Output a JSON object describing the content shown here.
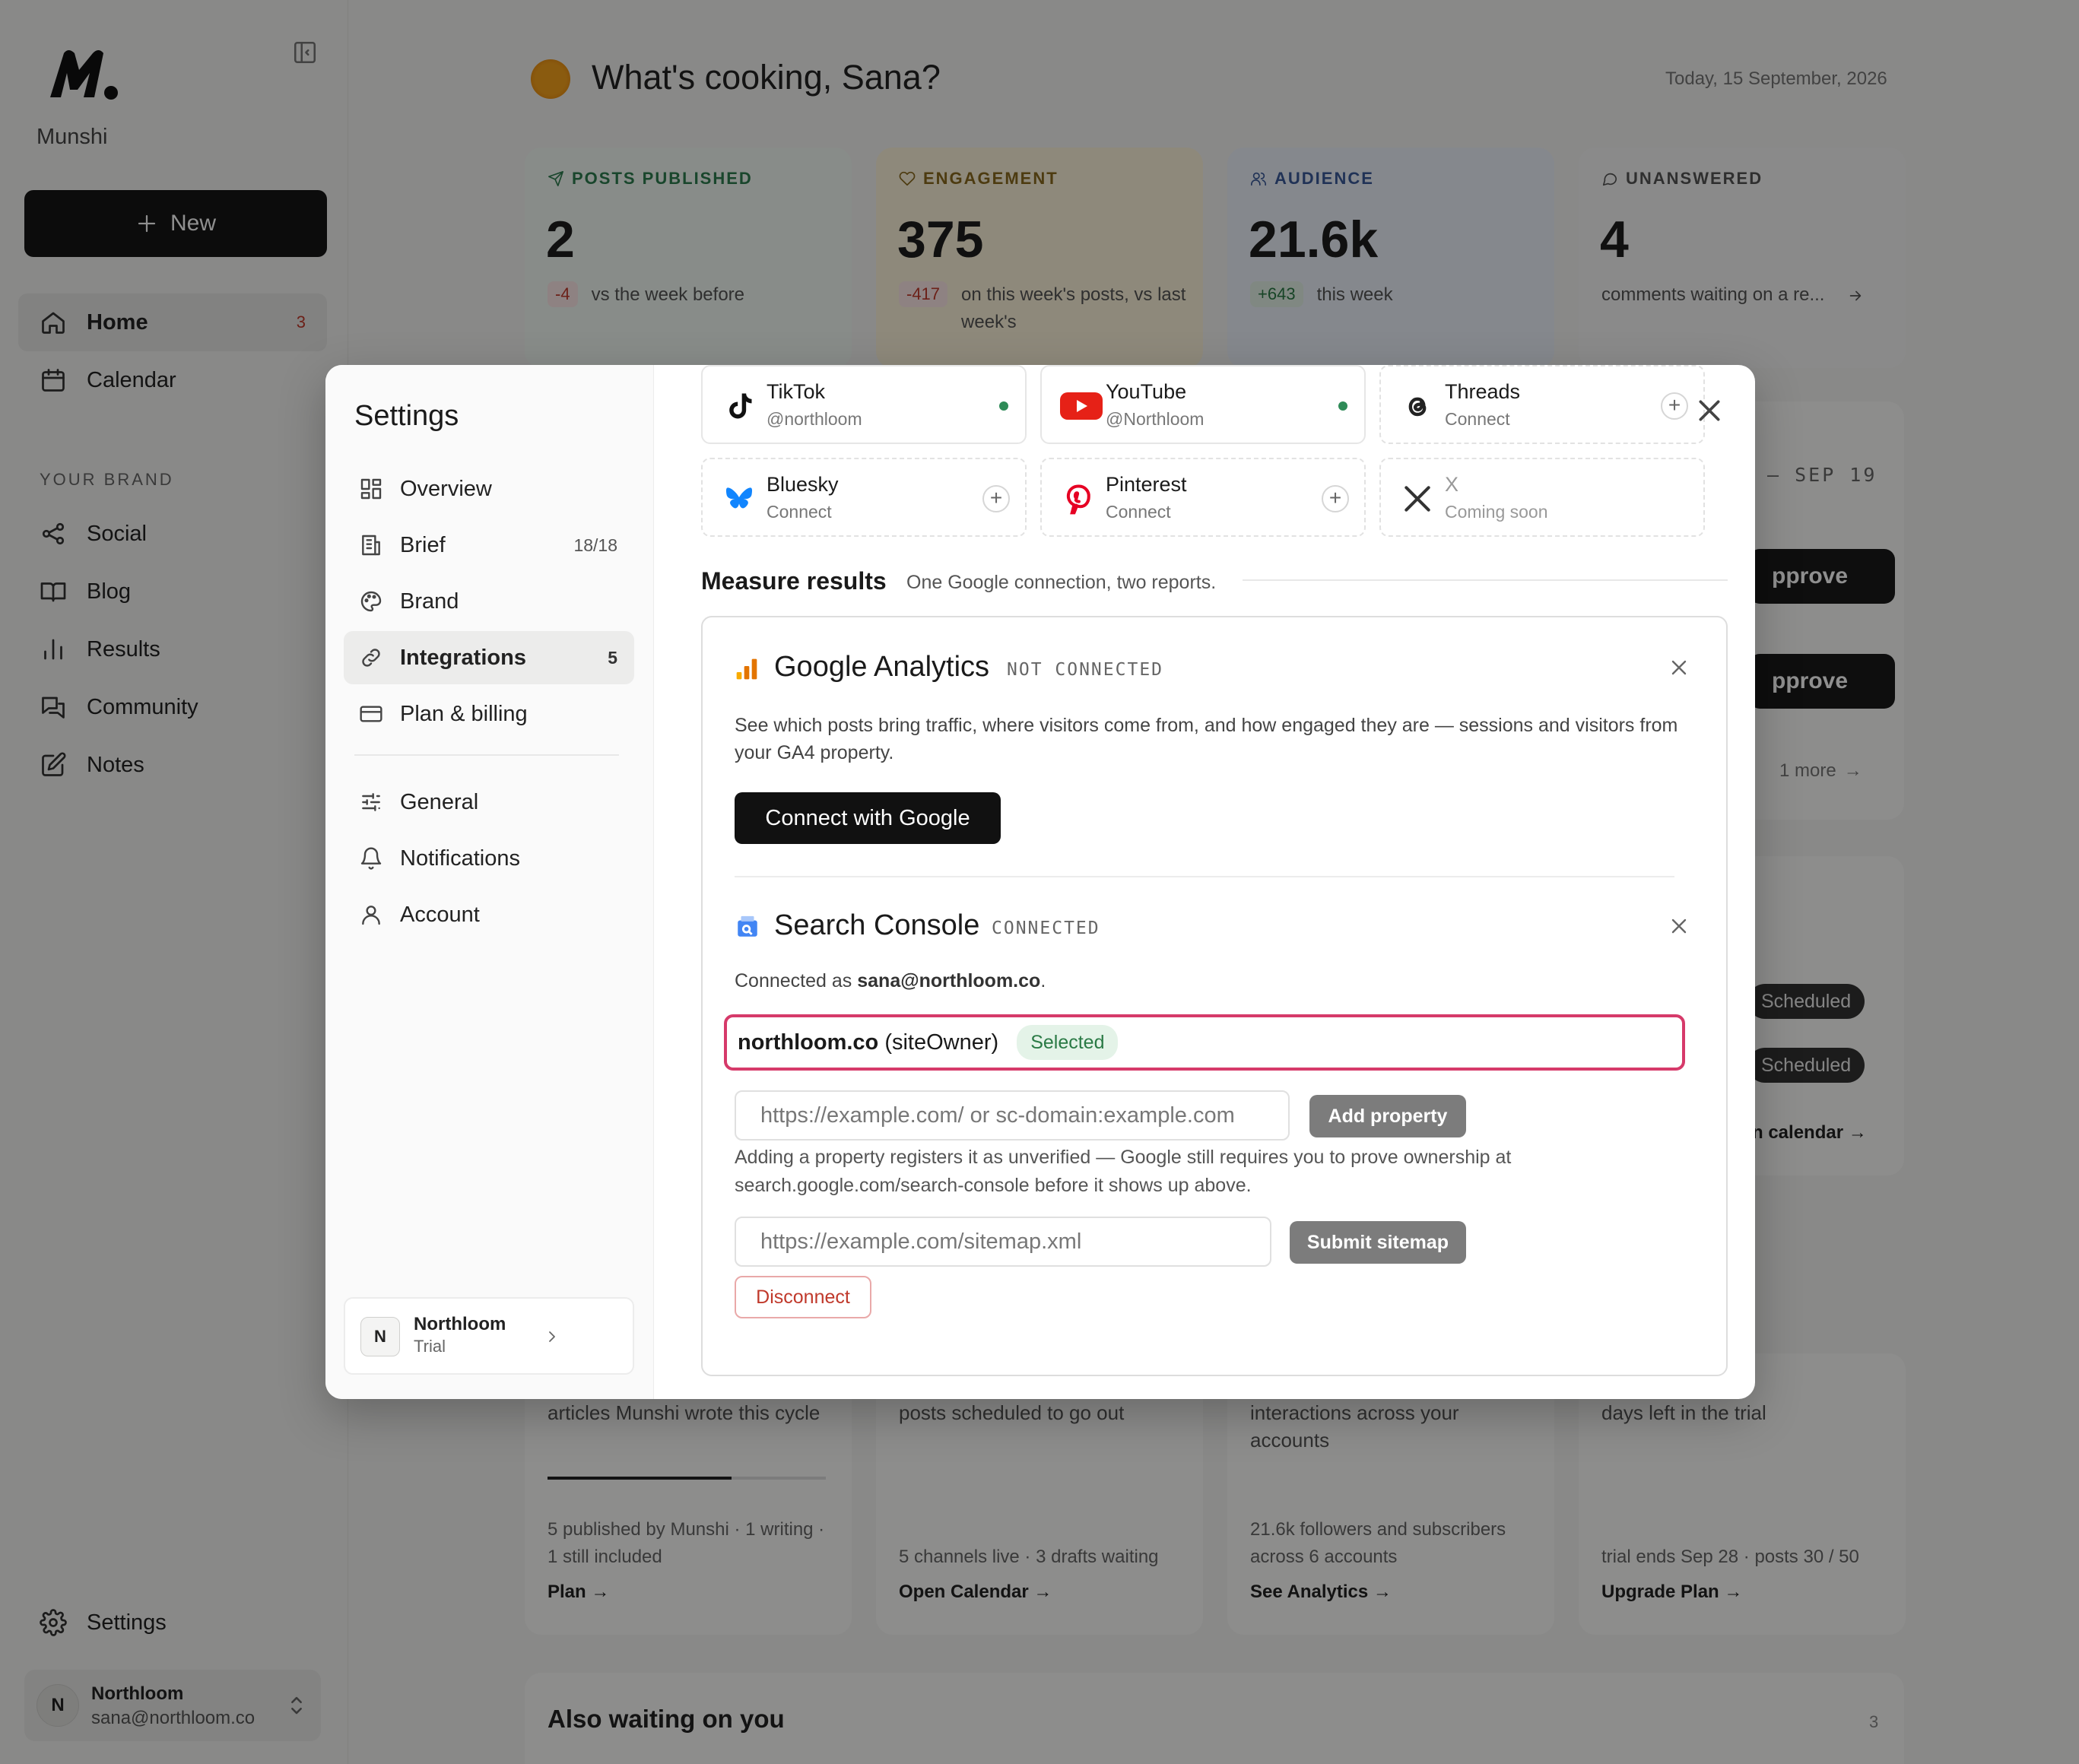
{
  "app": {
    "name": "Munshi"
  },
  "sidebar": {
    "new_label": "New",
    "nav": [
      {
        "label": "Home",
        "badge": "3"
      },
      {
        "label": "Calendar"
      }
    ],
    "section_label": "YOUR BRAND",
    "brand_nav": [
      {
        "label": "Social"
      },
      {
        "label": "Blog"
      },
      {
        "label": "Results"
      },
      {
        "label": "Community"
      },
      {
        "label": "Notes"
      }
    ],
    "settings_label": "Settings",
    "user": {
      "initial": "N",
      "name": "Northloom",
      "email": "sana@northloom.co"
    }
  },
  "main": {
    "greeting": "What's cooking, Sana?",
    "date": "Today, 15 September, 2026",
    "stats": [
      {
        "label": "POSTS PUBLISHED",
        "value": "2",
        "delta": "-4",
        "note": "vs the week before",
        "color": "#2e7d4f"
      },
      {
        "label": "ENGAGEMENT",
        "value": "375",
        "delta": "-417",
        "note": "on this week's posts, vs last week's",
        "color": "#8a6a1e"
      },
      {
        "label": "AUDIENCE",
        "value": "21.6k",
        "delta": "+643",
        "note": "this week",
        "color": "#3a5a9a"
      },
      {
        "label": "UNANSWERED",
        "value": "4",
        "delta": "",
        "note": "comments waiting on a re...",
        "color": "#555555"
      }
    ],
    "bottom_cards": [
      {
        "text": "articles Munshi wrote this cycle",
        "sub": "5 published by Munshi · 1 writing · 1 still included",
        "link": "Plan →",
        "progress": 0.66
      },
      {
        "text": "posts scheduled to go out",
        "sub": "5 channels live · 3 drafts waiting",
        "link": "Open Calendar →"
      },
      {
        "text": "interactions across your accounts",
        "sub": "21.6k followers and subscribers across 6 accounts",
        "link": "See Analytics →"
      },
      {
        "text": "days left in the trial",
        "sub": "trial ends Sep 28 · posts 30 / 50",
        "link": "Upgrade Plan →"
      }
    ],
    "right_panel": {
      "date_range": "– SEP 19",
      "approve_1": "pprove",
      "approve_2": "pprove",
      "more": "1 more",
      "scheduled_1": "Scheduled",
      "scheduled_2": "Scheduled",
      "calendar_link": "n calendar →"
    },
    "waiting_title": "Also waiting on you",
    "waiting_count": "3"
  },
  "settings": {
    "title": "Settings",
    "nav": [
      {
        "label": "Overview",
        "icon": "grid-icon"
      },
      {
        "label": "Brief",
        "count": "18/18",
        "icon": "building-icon"
      },
      {
        "label": "Brand",
        "icon": "palette-icon"
      },
      {
        "label": "Integrations",
        "count": "5",
        "icon": "link-icon"
      },
      {
        "label": "Plan & billing",
        "icon": "card-icon"
      }
    ],
    "nav2": [
      {
        "label": "General",
        "icon": "sliders-icon"
      },
      {
        "label": "Notifications",
        "icon": "bell-icon"
      },
      {
        "label": "Account",
        "icon": "user-icon"
      }
    ],
    "org": {
      "initial": "N",
      "name": "Northloom",
      "plan": "Trial"
    },
    "channels": [
      {
        "name": "TikTok",
        "handle": "@northloom",
        "connected": true
      },
      {
        "name": "YouTube",
        "handle": "@Northloom",
        "connected": true
      },
      {
        "name": "Threads",
        "handle": "Connect",
        "connected": false
      },
      {
        "name": "Bluesky",
        "handle": "Connect",
        "connected": false
      },
      {
        "name": "Pinterest",
        "handle": "Connect",
        "connected": false
      },
      {
        "name": "X",
        "handle": "Coming soon",
        "connected": false
      }
    ],
    "measure_title": "Measure results",
    "measure_sub": "One Google connection, two reports.",
    "ga": {
      "title": "Google Analytics",
      "status": "NOT CONNECTED",
      "desc": "See which posts bring traffic, where visitors come from, and how engaged they are — sessions and visitors from your GA4 property.",
      "button": "Connect with Google"
    },
    "sc": {
      "title": "Search Console",
      "status": "CONNECTED",
      "connected_as_prefix": "Connected as",
      "email": "sana@northloom.co",
      "property_name": "northloom.co",
      "property_role": "(siteOwner)",
      "selected": "Selected",
      "property_placeholder": "https://example.com/ or sc-domain:example.com",
      "add_property": "Add property",
      "help": "Adding a property registers it as unverified — Google still requires you to prove ownership at search.google.com/search-console before it shows up above.",
      "sitemap_placeholder": "https://example.com/sitemap.xml",
      "submit_sitemap": "Submit sitemap",
      "disconnect": "Disconnect"
    }
  }
}
